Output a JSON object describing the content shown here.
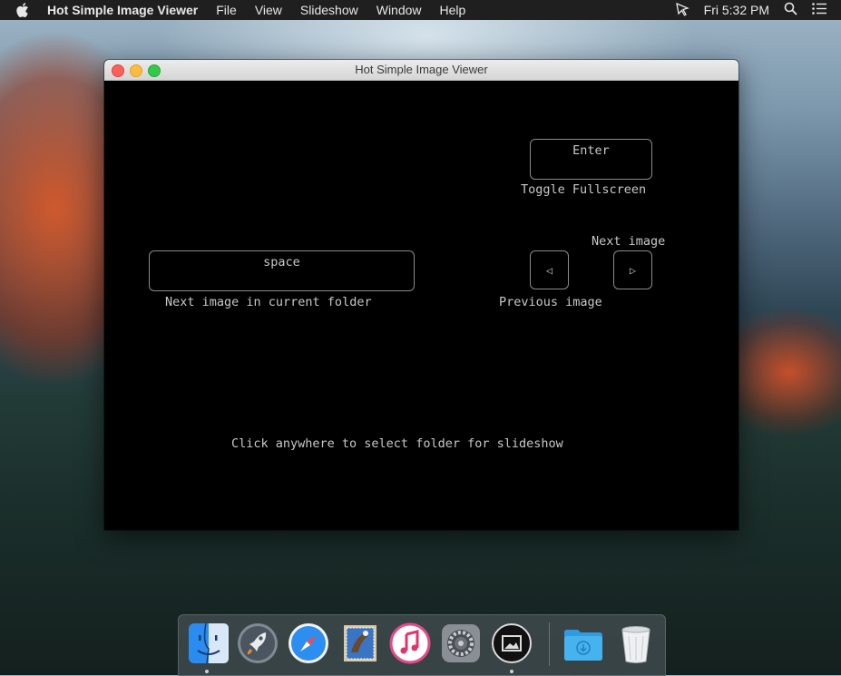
{
  "menubar": {
    "app_name": "Hot Simple Image Viewer",
    "items": [
      "File",
      "View",
      "Slideshow",
      "Window",
      "Help"
    ],
    "clock": "Fri 5:32 PM",
    "status_icons": [
      "cursor-flag-icon",
      "search-icon",
      "list-icon"
    ]
  },
  "window": {
    "title": "Hot Simple Image Viewer",
    "keys": {
      "enter": "Enter",
      "enter_caption": "Toggle Fullscreen",
      "space": "space",
      "space_caption": "Next image in current folder",
      "next_caption": "Next image",
      "prev_caption": "Previous image",
      "prev_glyph": "◁",
      "next_glyph": "▷"
    },
    "hint": "Click anywhere to select folder for slideshow"
  },
  "dock": {
    "apps": [
      "finder-icon",
      "launchpad-icon",
      "safari-icon",
      "mail-icon",
      "itunes-icon",
      "system-preferences-icon",
      "image-viewer-icon",
      "downloads-folder-icon",
      "trash-icon"
    ]
  },
  "colors": {
    "window_bg": "#000000",
    "text": "#c8c8c8",
    "key_border": "#8a8a8a"
  }
}
